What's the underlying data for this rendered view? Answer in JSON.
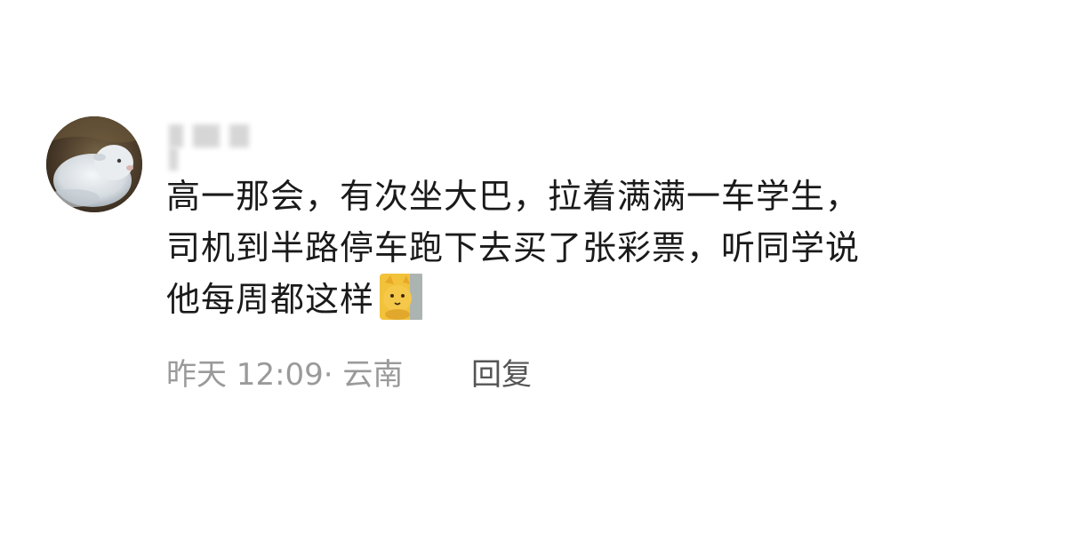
{
  "comment": {
    "avatar_icon": "sheep-avatar-icon",
    "username_hidden": true,
    "text_lines": [
      "高一那会，有次坐大巴，拉着满满一车学生，",
      "司机到半路停车跑下去买了张彩票，听同学说",
      "他每周都这样"
    ],
    "emoji": "cat-emoji-icon",
    "time": "昨天 12:09",
    "separator": "·",
    "location": "云南",
    "reply_label": "回复"
  }
}
